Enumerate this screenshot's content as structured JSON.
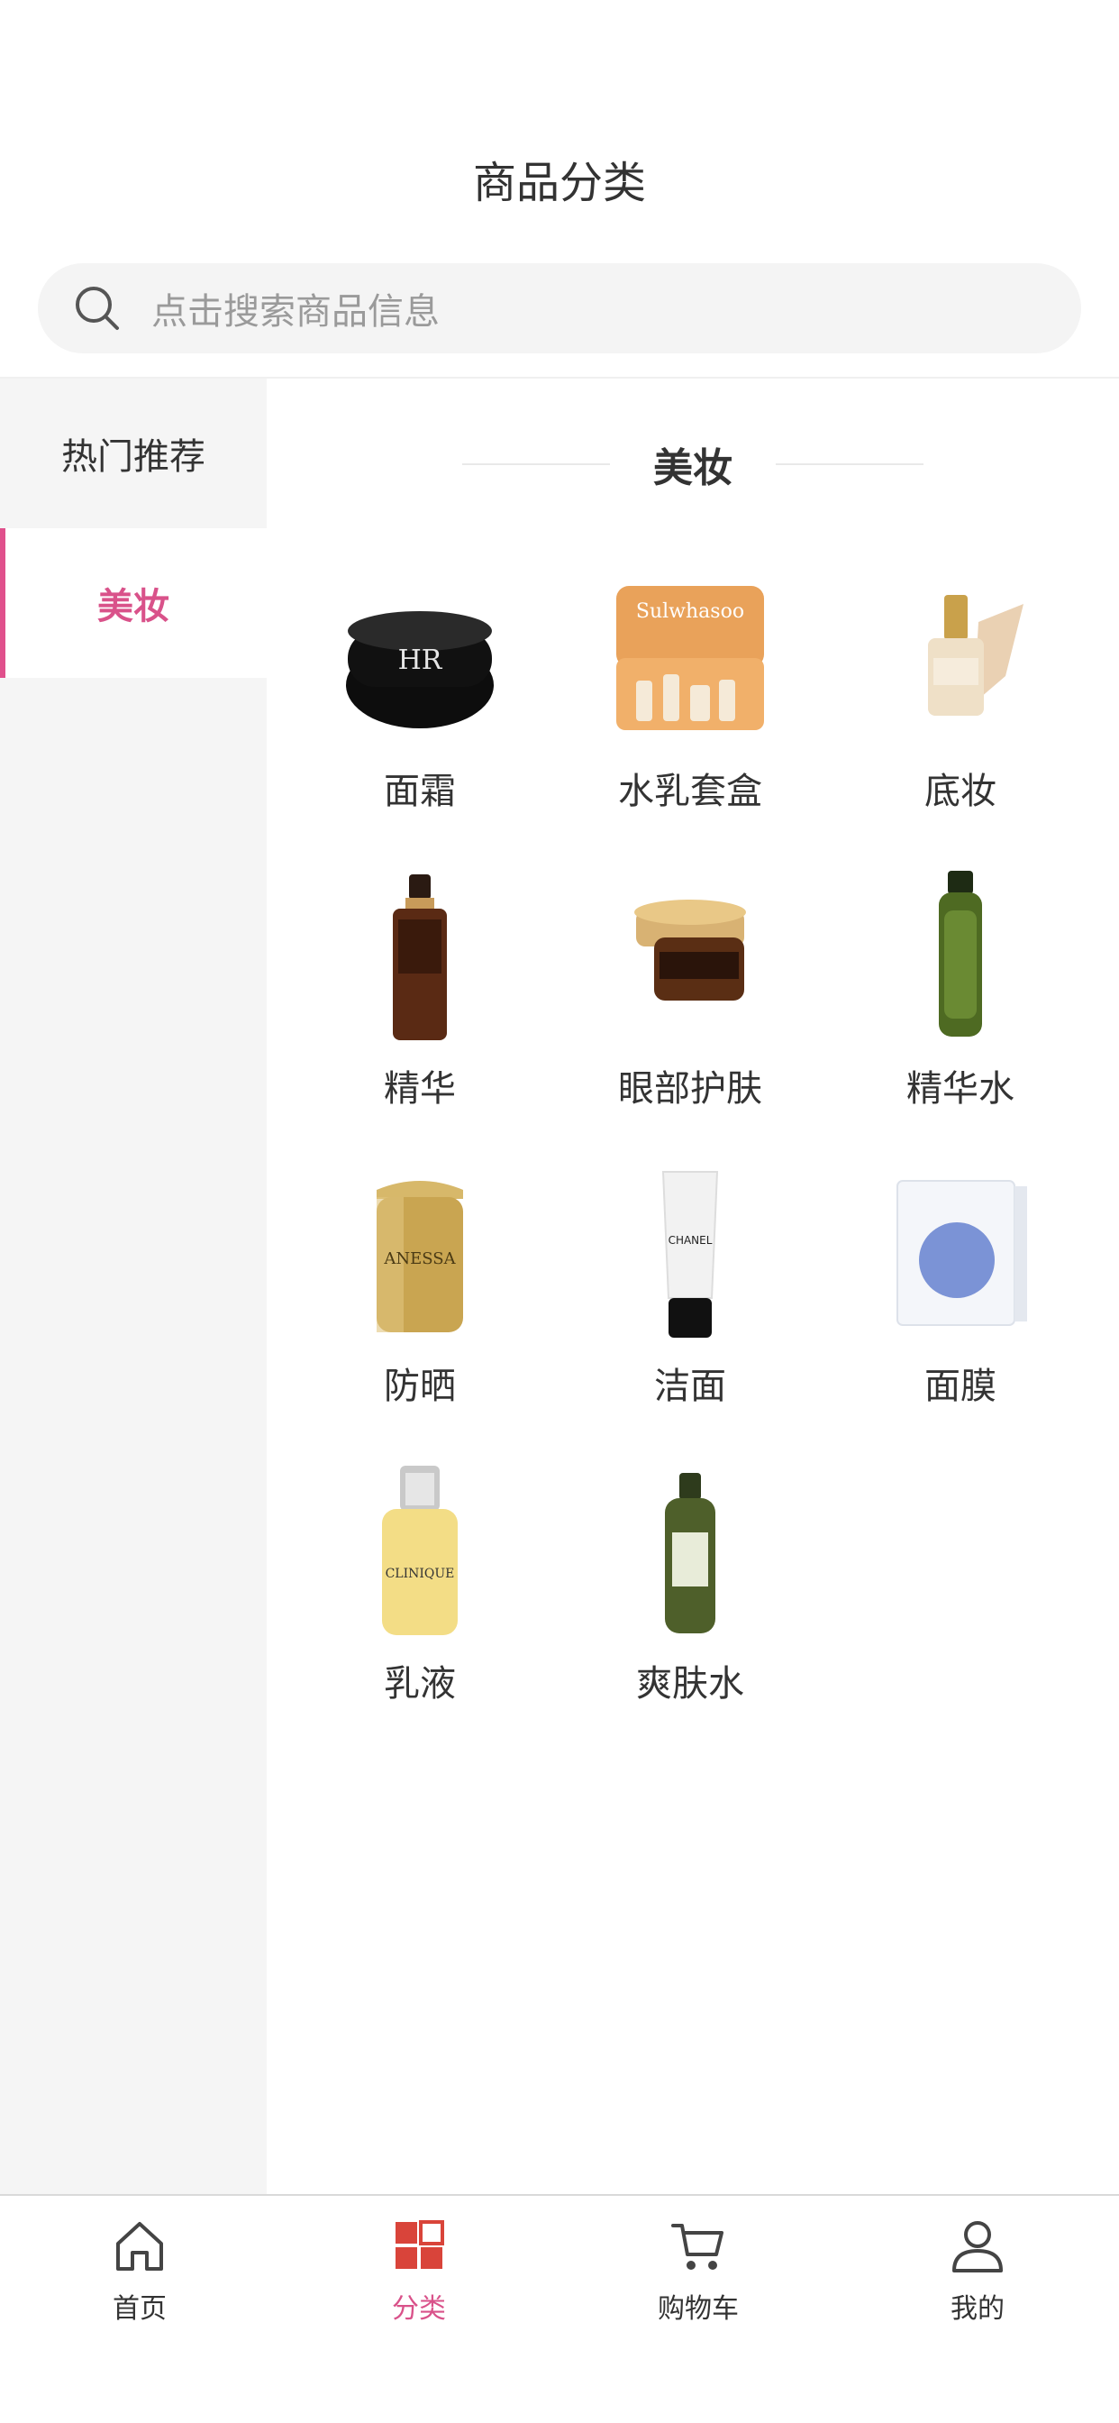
{
  "header": {
    "title": "商品分类"
  },
  "search": {
    "placeholder": "点击搜索商品信息",
    "icon": "search-icon"
  },
  "sidebar": {
    "items": [
      {
        "label": "热门推荐",
        "active": false
      },
      {
        "label": "美妆",
        "active": true
      }
    ]
  },
  "main": {
    "section_title": "美妆",
    "products": [
      {
        "name": "面霜",
        "image": "cream-jar"
      },
      {
        "name": "水乳套盒",
        "image": "gift-box"
      },
      {
        "name": "底妆",
        "image": "foundation-bottle"
      },
      {
        "name": "精华",
        "image": "serum-bottle"
      },
      {
        "name": "眼部护肤",
        "image": "eye-cream-jar"
      },
      {
        "name": "精华水",
        "image": "essence-bottle"
      },
      {
        "name": "防晒",
        "image": "sunscreen-bottle"
      },
      {
        "name": "洁面",
        "image": "cleanser-tube"
      },
      {
        "name": "面膜",
        "image": "mask-box"
      },
      {
        "name": "乳液",
        "image": "lotion-bottle"
      },
      {
        "name": "爽肤水",
        "image": "toner-bottle"
      }
    ]
  },
  "tabbar": {
    "tabs": [
      {
        "label": "首页",
        "icon": "home-icon",
        "active": false
      },
      {
        "label": "分类",
        "icon": "category-icon",
        "active": true
      },
      {
        "label": "购物车",
        "icon": "cart-icon",
        "active": false
      },
      {
        "label": "我的",
        "icon": "user-icon",
        "active": false
      }
    ]
  },
  "colors": {
    "accent": "#d9528a",
    "category_icon": "#d9443a"
  }
}
